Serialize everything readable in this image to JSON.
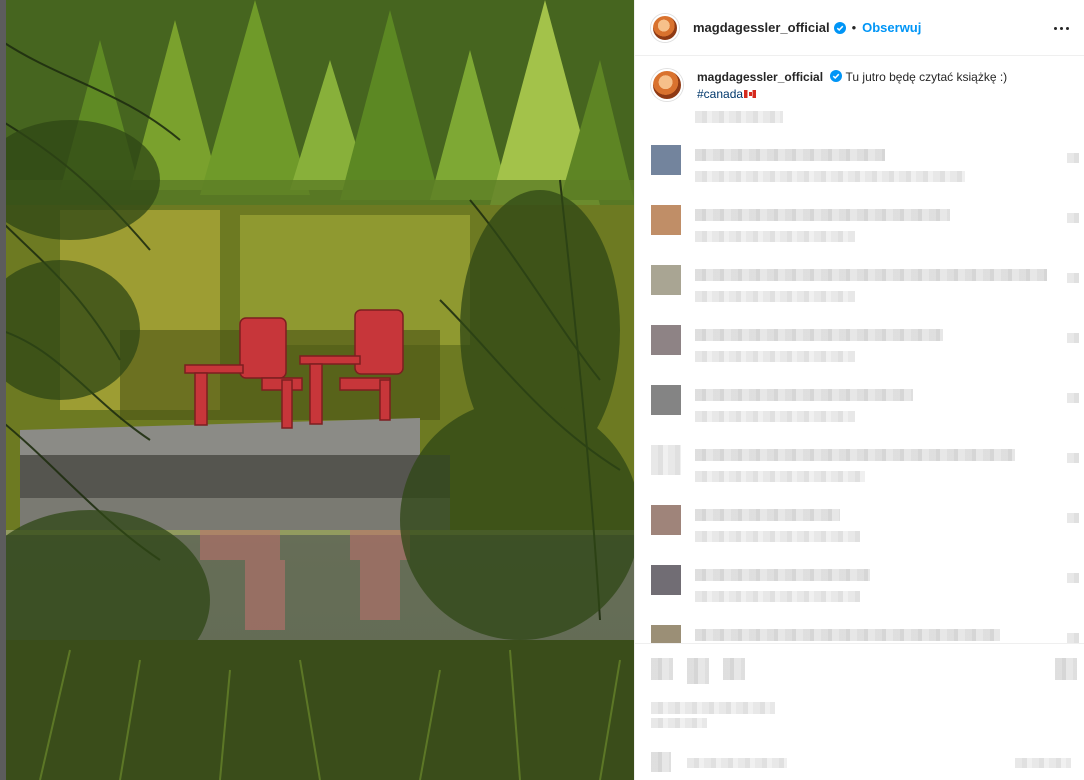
{
  "post": {
    "image_alt_subject": "",
    "author": "magdagessler_official",
    "follow_label": "Obserwuj",
    "separator": "•",
    "caption_text": "Tu jutro będę czytać książkę :)",
    "hashtag": "#canada"
  },
  "icons": {
    "more": "more-options-icon",
    "verified": "verified-badge-icon",
    "flag": "canada-flag-icon"
  },
  "colors": {
    "link": "#0095f6",
    "hashtag": "#00376b",
    "verified": "#0095f6",
    "chair": "#c7363a"
  }
}
